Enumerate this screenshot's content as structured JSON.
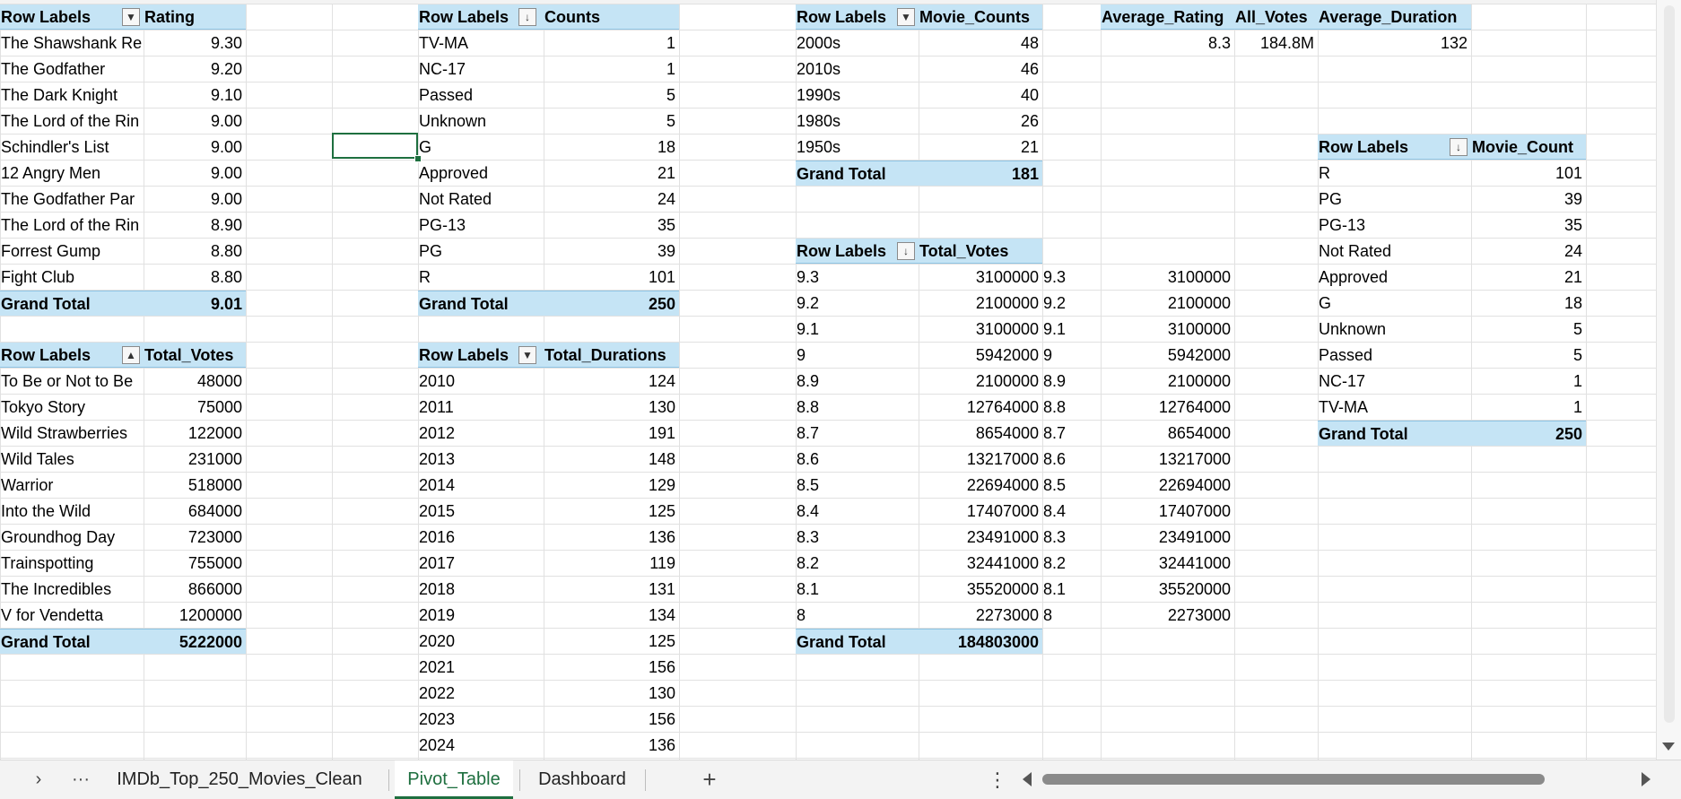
{
  "pivots": {
    "rating": {
      "header": [
        "Row Labels",
        "Rating"
      ],
      "rows": [
        [
          "The Shawshank Re",
          "9.30"
        ],
        [
          "The Godfather",
          "9.20"
        ],
        [
          "The Dark Knight",
          "9.10"
        ],
        [
          "The Lord of the Rin",
          "9.00"
        ],
        [
          "Schindler's List",
          "9.00"
        ],
        [
          "12 Angry Men",
          "9.00"
        ],
        [
          "The Godfather Par",
          "9.00"
        ],
        [
          "The Lord of the Rin",
          "8.90"
        ],
        [
          "Forrest Gump",
          "8.80"
        ],
        [
          "Fight Club",
          "8.80"
        ]
      ],
      "total": [
        "Grand Total",
        "9.01"
      ]
    },
    "votes_by_title": {
      "header": [
        "Row Labels",
        "Total_Votes"
      ],
      "rows": [
        [
          "To Be or Not to Be",
          "48000"
        ],
        [
          "Tokyo Story",
          "75000"
        ],
        [
          "Wild Strawberries",
          "122000"
        ],
        [
          "Wild Tales",
          "231000"
        ],
        [
          "Warrior",
          "518000"
        ],
        [
          "Into the Wild",
          "684000"
        ],
        [
          "Groundhog Day",
          "723000"
        ],
        [
          "Trainspotting",
          "755000"
        ],
        [
          "The Incredibles",
          "866000"
        ],
        [
          "V for Vendetta",
          "1200000"
        ]
      ],
      "total": [
        "Grand Total",
        "5222000"
      ]
    },
    "counts": {
      "header": [
        "Row Labels",
        "Counts"
      ],
      "rows": [
        [
          "TV-MA",
          "1"
        ],
        [
          "NC-17",
          "1"
        ],
        [
          "Passed",
          "5"
        ],
        [
          "Unknown",
          "5"
        ],
        [
          "G",
          "18"
        ],
        [
          "Approved",
          "21"
        ],
        [
          "Not Rated",
          "24"
        ],
        [
          "PG-13",
          "35"
        ],
        [
          "PG",
          "39"
        ],
        [
          "R",
          "101"
        ]
      ],
      "total": [
        "Grand Total",
        "250"
      ]
    },
    "durations": {
      "header": [
        "Row Labels",
        "Total_Durations"
      ],
      "rows": [
        [
          "2010",
          "124"
        ],
        [
          "2011",
          "130"
        ],
        [
          "2012",
          "191"
        ],
        [
          "2013",
          "148"
        ],
        [
          "2014",
          "129"
        ],
        [
          "2015",
          "125"
        ],
        [
          "2016",
          "136"
        ],
        [
          "2017",
          "119"
        ],
        [
          "2018",
          "131"
        ],
        [
          "2019",
          "134"
        ],
        [
          "2020",
          "125"
        ],
        [
          "2021",
          "156"
        ],
        [
          "2022",
          "130"
        ],
        [
          "2023",
          "156"
        ],
        [
          "2024",
          "136"
        ]
      ]
    },
    "decades": {
      "header": [
        "Row Labels",
        "Movie_Counts"
      ],
      "rows": [
        [
          "2000s",
          "48"
        ],
        [
          "2010s",
          "46"
        ],
        [
          "1990s",
          "40"
        ],
        [
          "1980s",
          "26"
        ],
        [
          "1950s",
          "21"
        ]
      ],
      "total": [
        "Grand Total",
        "181"
      ]
    },
    "votes_by_rating": {
      "header": [
        "Row Labels",
        "Total_Votes"
      ],
      "rows": [
        [
          "9.3",
          "3100000"
        ],
        [
          "9.2",
          "2100000"
        ],
        [
          "9.1",
          "3100000"
        ],
        [
          "9",
          "5942000"
        ],
        [
          "8.9",
          "2100000"
        ],
        [
          "8.8",
          "12764000"
        ],
        [
          "8.7",
          "8654000"
        ],
        [
          "8.6",
          "13217000"
        ],
        [
          "8.5",
          "22694000"
        ],
        [
          "8.4",
          "17407000"
        ],
        [
          "8.3",
          "23491000"
        ],
        [
          "8.2",
          "32441000"
        ],
        [
          "8.1",
          "35520000"
        ],
        [
          "8",
          "2273000"
        ]
      ],
      "total": [
        "Grand Total",
        "184803000"
      ]
    },
    "summary": {
      "header": [
        "Average_Rating",
        "All_Votes",
        "Average_Duration"
      ],
      "values": [
        "8.3",
        "184.8M",
        "132"
      ]
    },
    "movie_count": {
      "header": [
        "Row Labels",
        "Movie_Count"
      ],
      "rows": [
        [
          "R",
          "101"
        ],
        [
          "PG",
          "39"
        ],
        [
          "PG-13",
          "35"
        ],
        [
          "Not Rated",
          "24"
        ],
        [
          "Approved",
          "21"
        ],
        [
          "G",
          "18"
        ],
        [
          "Unknown",
          "5"
        ],
        [
          "Passed",
          "5"
        ],
        [
          "NC-17",
          "1"
        ],
        [
          "TV-MA",
          "1"
        ]
      ],
      "total": [
        "Grand Total",
        "250"
      ]
    }
  },
  "copy_votes": [
    [
      "9.3",
      "3100000"
    ],
    [
      "9.2",
      "2100000"
    ],
    [
      "9.1",
      "3100000"
    ],
    [
      "9",
      "5942000"
    ],
    [
      "8.9",
      "2100000"
    ],
    [
      "8.8",
      "12764000"
    ],
    [
      "8.7",
      "8654000"
    ],
    [
      "8.6",
      "13217000"
    ],
    [
      "8.5",
      "22694000"
    ],
    [
      "8.4",
      "17407000"
    ],
    [
      "8.3",
      "23491000"
    ],
    [
      "8.2",
      "32441000"
    ],
    [
      "8.1",
      "35520000"
    ],
    [
      "8",
      "2273000"
    ]
  ],
  "filter_icons": {
    "rating": "▼",
    "counts": "↓",
    "decades": "▼",
    "votes_by_rating": "↓",
    "votes_by_title": "▲",
    "durations": "▼",
    "movie_count": "↓"
  },
  "tabs": {
    "nav_next": "›",
    "more": "···",
    "sheets": [
      "IMDb_Top_250_Movies_Clean",
      "Pivot_Table",
      "Dashboard"
    ],
    "active": "Pivot_Table",
    "add": "+",
    "options": "⋮"
  },
  "icons": {
    "scroll_up": "scroll-up-icon",
    "scroll_down": "scroll-down-icon",
    "filter": "filter-icon"
  }
}
